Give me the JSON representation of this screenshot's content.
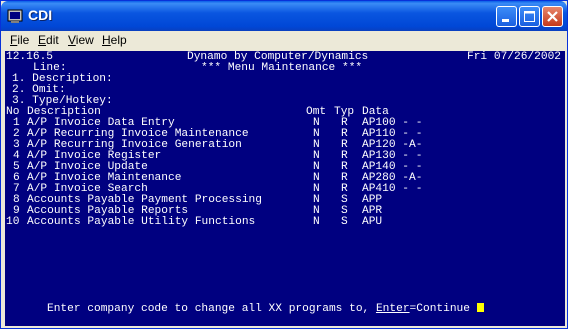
{
  "window": {
    "title": "CDI",
    "icon": "cdi-app-icon",
    "controls": [
      "minimize-icon",
      "maximize-icon",
      "close-icon"
    ]
  },
  "menubar": {
    "file": {
      "acc": "F",
      "rest": "ile"
    },
    "edit": {
      "acc": "E",
      "rest": "dit"
    },
    "view": {
      "acc": "V",
      "rest": "iew"
    },
    "help": {
      "acc": "H",
      "rest": "elp"
    }
  },
  "terminal": {
    "colors": {
      "background": "#000080",
      "text": "#ffffff",
      "cursor": "#ffff00"
    },
    "header": {
      "version": "12.16.5",
      "app_title": "Dynamo by Computer/Dynamics",
      "date": "Fri 07/26/2002",
      "line_label": "Line:",
      "screen_title": "*** Menu Maintenance ***"
    },
    "fields": [
      "1. Description:",
      "2. Omit:",
      "3. Type/Hotkey:"
    ],
    "columns": {
      "no": "No",
      "description": "Description",
      "omit": "Omt",
      "type": "Typ",
      "data": "Data"
    },
    "rows": [
      {
        "no": "1",
        "desc": "A/P Invoice Data Entry",
        "omit": "N",
        "typ": "R",
        "data": "AP100 - -"
      },
      {
        "no": "2",
        "desc": "A/P Recurring Invoice Maintenance",
        "omit": "N",
        "typ": "R",
        "data": "AP110 - -"
      },
      {
        "no": "3",
        "desc": "A/P Recurring Invoice Generation",
        "omit": "N",
        "typ": "R",
        "data": "AP120 -A-"
      },
      {
        "no": "4",
        "desc": "A/P Invoice Register",
        "omit": "N",
        "typ": "R",
        "data": "AP130 - -"
      },
      {
        "no": "5",
        "desc": "A/P Invoice Update",
        "omit": "N",
        "typ": "R",
        "data": "AP140 - -"
      },
      {
        "no": "6",
        "desc": "A/P Invoice Maintenance",
        "omit": "N",
        "typ": "R",
        "data": "AP280 -A-"
      },
      {
        "no": "7",
        "desc": "A/P Invoice Search",
        "omit": "N",
        "typ": "R",
        "data": "AP410 - -"
      },
      {
        "no": "8",
        "desc": "Accounts Payable Payment Processing",
        "omit": "N",
        "typ": "S",
        "data": "APP"
      },
      {
        "no": "9",
        "desc": "Accounts Payable Reports",
        "omit": "N",
        "typ": "S",
        "data": "APR"
      },
      {
        "no": "10",
        "desc": "Accounts Payable Utility Functions",
        "omit": "N",
        "typ": "S",
        "data": "APU"
      }
    ],
    "prompt": {
      "text": "Enter company code to change all XX programs to, ",
      "key": "Enter",
      "action": "=Continue"
    }
  }
}
